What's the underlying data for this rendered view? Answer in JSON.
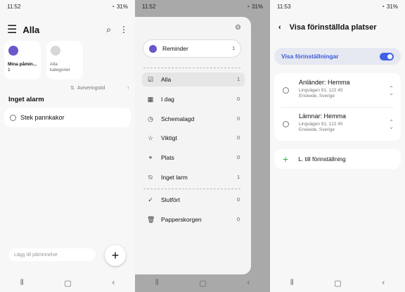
{
  "screen1": {
    "status": {
      "time": "11:52",
      "battery": "31%"
    },
    "title": "Alla",
    "tiles": [
      {
        "label": "Mina påmin...",
        "count": "1",
        "color": "#6a57c9"
      },
      {
        "label": "Alla kategorier",
        "count": "",
        "color": "#cfcfcf"
      }
    ],
    "sort_label": "Aviseringstid",
    "section": "Inget alarm",
    "task": "Stek pannkakor",
    "add_placeholder": "Lägg till påminnelse",
    "fab": "+"
  },
  "screen2": {
    "status": {
      "time": "11:52",
      "battery": "31%"
    },
    "reminder": {
      "label": "Reminder",
      "count": "1"
    },
    "items": [
      {
        "label": "Alla",
        "count": "1",
        "icon": "checklist-icon"
      },
      {
        "label": "I dag",
        "count": "0",
        "icon": "calendar-icon"
      },
      {
        "label": "Schemalagd",
        "count": "0",
        "icon": "clock-icon"
      },
      {
        "label": "Viktigt",
        "count": "0",
        "icon": "star-icon"
      },
      {
        "label": "Plats",
        "count": "0",
        "icon": "location-icon"
      },
      {
        "label": "Inget larm",
        "count": "1",
        "icon": "bell-off-icon"
      },
      {
        "label": "Slutfört",
        "count": "0",
        "icon": "check-icon"
      },
      {
        "label": "Papperskorgen",
        "count": "0",
        "icon": "trash-icon"
      }
    ]
  },
  "screen3": {
    "status": {
      "time": "11:53",
      "battery": "31%"
    },
    "title": "Visa förinställda platser",
    "toggle_label": "Visa förinställningar",
    "locations": [
      {
        "title": "Anländer: Hemma",
        "address": "Lingvägen 91, 122 45 Enskede, Sverige"
      },
      {
        "title": "Lämnar: Hemma",
        "address": "Lingvägen 91, 122 45 Enskede, Sverige"
      }
    ],
    "add_label": "L. till förinställning"
  },
  "accent": "#3f63e6"
}
